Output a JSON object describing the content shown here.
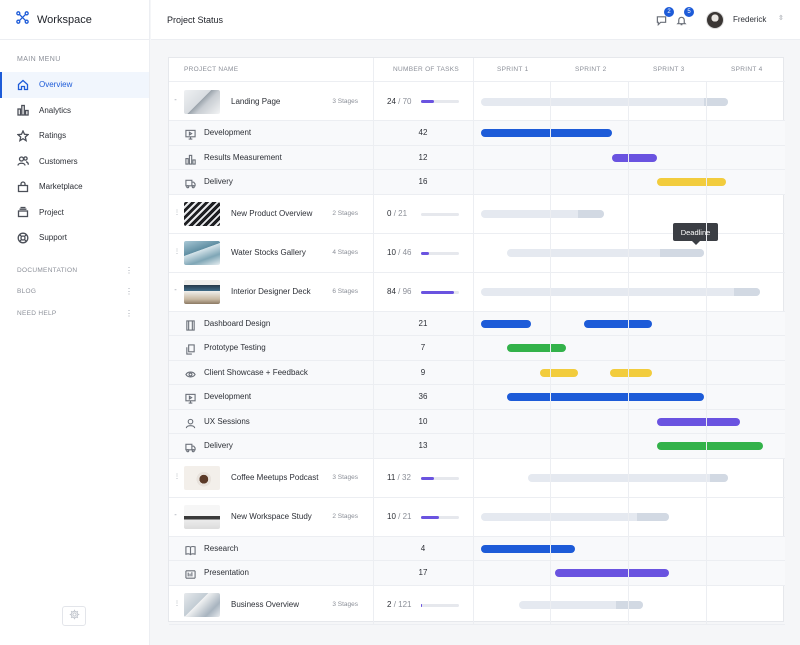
{
  "brand": {
    "name": "Workspace"
  },
  "sidebar": {
    "main_menu_label": "MAIN MENU",
    "items": [
      {
        "label": "Overview",
        "icon": "home-icon",
        "active": true
      },
      {
        "label": "Analytics",
        "icon": "bar-chart-icon"
      },
      {
        "label": "Ratings",
        "icon": "star-icon"
      },
      {
        "label": "Customers",
        "icon": "users-icon"
      },
      {
        "label": "Marketplace",
        "icon": "shopping-bag-icon"
      },
      {
        "label": "Project",
        "icon": "stack-icon"
      },
      {
        "label": "Support",
        "icon": "lifebuoy-icon"
      }
    ],
    "sections": [
      {
        "label": "DOCUMENTATION"
      },
      {
        "label": "BLOG"
      },
      {
        "label": "NEED HELP"
      }
    ]
  },
  "header": {
    "title": "Project Status",
    "messages_count": "2",
    "notifications_count": "5",
    "user_name": "Frederick"
  },
  "table": {
    "columns": {
      "project_name": "PROJECT NAME",
      "number_of_tasks": "NUMBER OF TASKS",
      "sprints": [
        "SPRINT 1",
        "SPRINT 2",
        "SPRINT 3",
        "SPRINT 4"
      ]
    },
    "tooltip": "Deadline",
    "colors": {
      "blue": "#1d5bd8",
      "purple": "#6a53e0",
      "yellow": "#f2cc3d",
      "green": "#33b24a",
      "track": "#e5e9f0",
      "track_done": "#d2d9e3"
    },
    "projects": [
      {
        "name": "Landing Page",
        "stages": "3 Stages",
        "done": "24",
        "total": "/ 70",
        "progress": 0.34,
        "expanded": true,
        "thumb": "laptop-desk",
        "track": [
          0.0,
          0.84
        ],
        "track_done": [
          0.76,
          0.84
        ],
        "tasks": [
          {
            "name": "Development",
            "icon": "monitor-icon",
            "count": "42",
            "bars": [
              {
                "color": "blue",
                "span": [
                  0.0,
                  0.445
                ]
              }
            ]
          },
          {
            "name": "Results Measurement",
            "icon": "bar-chart-icon",
            "count": "12",
            "bars": [
              {
                "color": "purple",
                "span": [
                  0.445,
                  0.6
                ]
              }
            ]
          },
          {
            "name": "Delivery",
            "icon": "truck-icon",
            "count": "16",
            "bars": [
              {
                "color": "yellow",
                "span": [
                  0.6,
                  0.835
                ]
              }
            ]
          }
        ]
      },
      {
        "name": "New Product Overview",
        "stages": "2 Stages",
        "done": "0",
        "total": "/ 21",
        "progress": 0.0,
        "expanded": false,
        "thumb": "keyboard",
        "track": [
          0.0,
          0.42
        ],
        "track_done": [
          0.33,
          0.42
        ],
        "tasks": []
      },
      {
        "name": "Water Stocks Gallery",
        "stages": "4 Stages",
        "done": "10",
        "total": "/ 46",
        "progress": 0.22,
        "expanded": false,
        "thumb": "building",
        "track": [
          0.09,
          0.76
        ],
        "track_done": [
          0.61,
          0.76
        ],
        "tasks": []
      },
      {
        "name": "Interior Designer Deck",
        "stages": "6 Stages",
        "done": "84",
        "total": "/ 96",
        "progress": 0.88,
        "expanded": true,
        "thumb": "monitor-desk",
        "track": [
          0.0,
          0.95
        ],
        "track_done": [
          0.86,
          0.95
        ],
        "tasks": [
          {
            "name": "Dashboard Design",
            "icon": "layout-icon",
            "count": "21",
            "bars": [
              {
                "color": "blue",
                "span": [
                  0.0,
                  0.17
                ]
              },
              {
                "color": "blue",
                "span": [
                  0.35,
                  0.58
                ]
              }
            ]
          },
          {
            "name": "Prototype Testing",
            "icon": "copy-icon",
            "count": "7",
            "bars": [
              {
                "color": "green",
                "span": [
                  0.09,
                  0.29
                ]
              }
            ]
          },
          {
            "name": "Client Showcase + Feedback",
            "icon": "eye-icon",
            "count": "9",
            "bars": [
              {
                "color": "yellow",
                "span": [
                  0.2,
                  0.33
                ]
              },
              {
                "color": "yellow",
                "span": [
                  0.44,
                  0.58
                ]
              }
            ]
          },
          {
            "name": "Development",
            "icon": "monitor-icon",
            "count": "36",
            "bars": [
              {
                "color": "blue",
                "span": [
                  0.09,
                  0.76
                ]
              }
            ]
          },
          {
            "name": "UX Sessions",
            "icon": "user-icon",
            "count": "10",
            "bars": [
              {
                "color": "purple",
                "span": [
                  0.6,
                  0.88
                ]
              }
            ]
          },
          {
            "name": "Delivery",
            "icon": "truck-icon",
            "count": "13",
            "bars": [
              {
                "color": "green",
                "span": [
                  0.6,
                  0.96
                ]
              }
            ]
          }
        ]
      },
      {
        "name": "Coffee Meetups Podcast",
        "stages": "3 Stages",
        "done": "11",
        "total": "/ 32",
        "progress": 0.34,
        "expanded": false,
        "thumb": "coffee-cup",
        "track": [
          0.16,
          0.84
        ],
        "track_done": [
          0.78,
          0.84
        ],
        "tasks": []
      },
      {
        "name": "New Workspace Study",
        "stages": "2 Stages",
        "done": "10",
        "total": "/ 21",
        "progress": 0.48,
        "expanded": true,
        "thumb": "workspace",
        "track": [
          0.0,
          0.64
        ],
        "track_done": [
          0.53,
          0.64
        ],
        "tasks": [
          {
            "name": "Research",
            "icon": "book-icon",
            "count": "4",
            "bars": [
              {
                "color": "blue",
                "span": [
                  0.0,
                  0.32
                ]
              }
            ]
          },
          {
            "name": "Presentation",
            "icon": "presentation-icon",
            "count": "17",
            "bars": [
              {
                "color": "purple",
                "span": [
                  0.25,
                  0.64
                ]
              }
            ]
          }
        ]
      },
      {
        "name": "Business Overview",
        "stages": "3 Stages",
        "done": "2",
        "total": "/ 121",
        "progress": 0.02,
        "expanded": false,
        "thumb": "office",
        "track": [
          0.13,
          0.55
        ],
        "track_done": [
          0.46,
          0.55
        ],
        "tasks": []
      }
    ]
  }
}
